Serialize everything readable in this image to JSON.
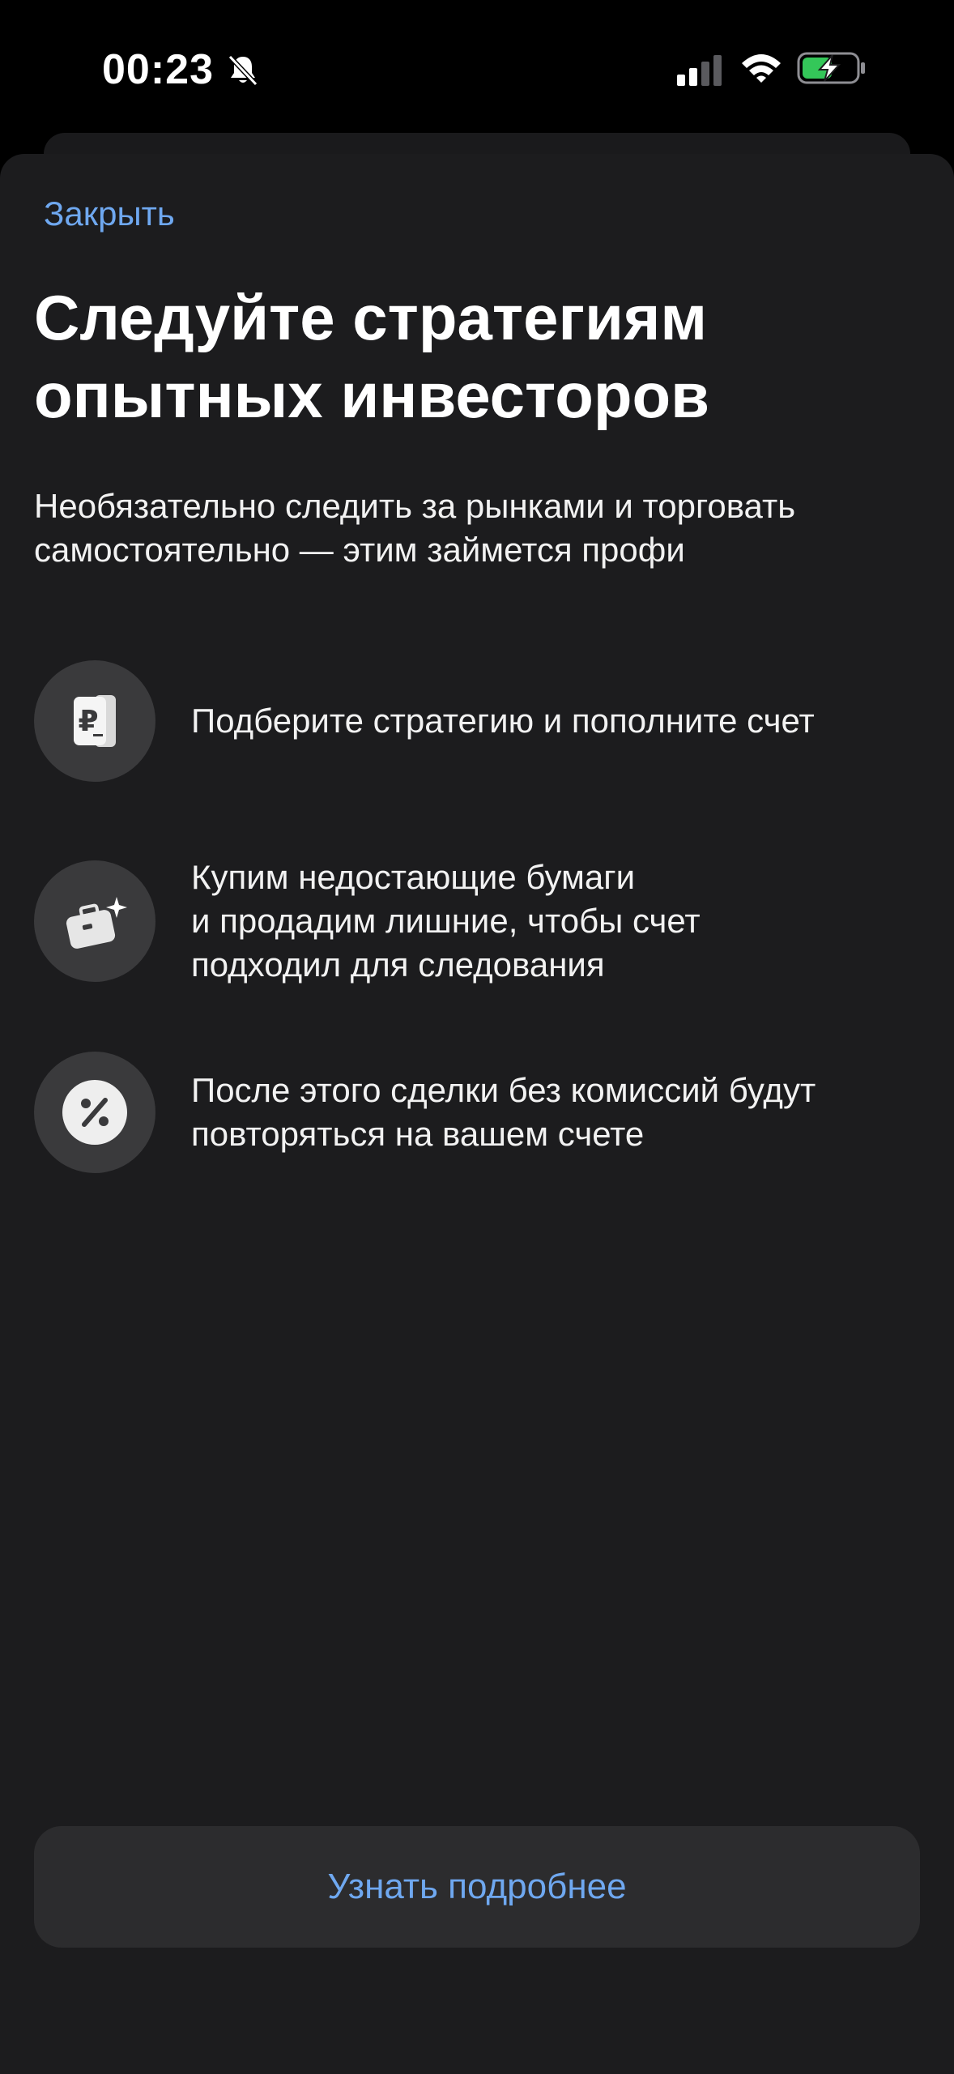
{
  "status_bar": {
    "time": "00:23",
    "icons": [
      "bell-slash-icon",
      "cellular-signal-icon",
      "wifi-icon",
      "battery-charging-icon"
    ]
  },
  "sheet": {
    "close_label": "Закрыть",
    "title": "Следуйте стратегиям опытных инвесторов",
    "subtitle": "Необязательно следить за рынками и торговать самостоятельно — этим займется профи",
    "features": [
      {
        "icon": "ruble-wallet-icon",
        "text": "Подберите стратегию и пополните счет"
      },
      {
        "icon": "briefcase-sparkle-icon",
        "text": "Купим недостающие бумаги\nи продадим лишние, чтобы счет\nподходил для следования"
      },
      {
        "icon": "percent-badge-icon",
        "text": "После этого сделки без комиссий будут\nповторяться на вашем счете"
      }
    ],
    "cta_label": "Узнать подробнее"
  },
  "colors": {
    "background": "#000000",
    "sheet": "#1c1c1e",
    "icon_circle": "#3a3a3c",
    "button": "#2c2c2e",
    "accent": "#6fa8f0",
    "battery": "#34c759"
  }
}
